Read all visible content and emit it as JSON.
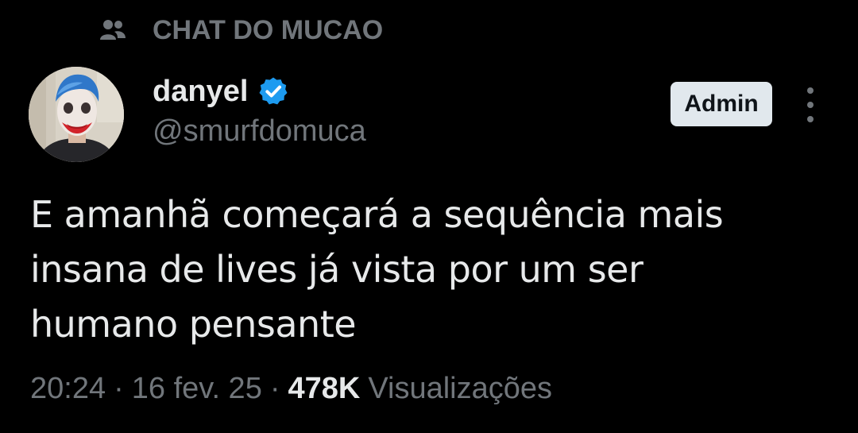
{
  "community": {
    "icon": "community-people-icon",
    "name": "CHAT DO MUCAO"
  },
  "author": {
    "avatar": "avatar-joker-makeup",
    "display_name": "danyel",
    "verified_icon": "verified-badge-icon",
    "handle": "@smurfdomuca",
    "badge": "Admin"
  },
  "more_icon": "more-vertical-icon",
  "tweet": {
    "line1": "E amanhã começará a sequência mais",
    "line2": "insana de lives já vista por um ser",
    "line3": "humano pensante"
  },
  "meta": {
    "time": "20:24",
    "separator": "·",
    "date": "16 fev. 25",
    "views_count": "478K",
    "views_label": "Visualizações"
  },
  "colors": {
    "background": "#000000",
    "primary_text": "#e7e9ea",
    "secondary_text": "#71767b",
    "verified_blue": "#1d9bf0",
    "badge_background": "#e1e8ed"
  }
}
